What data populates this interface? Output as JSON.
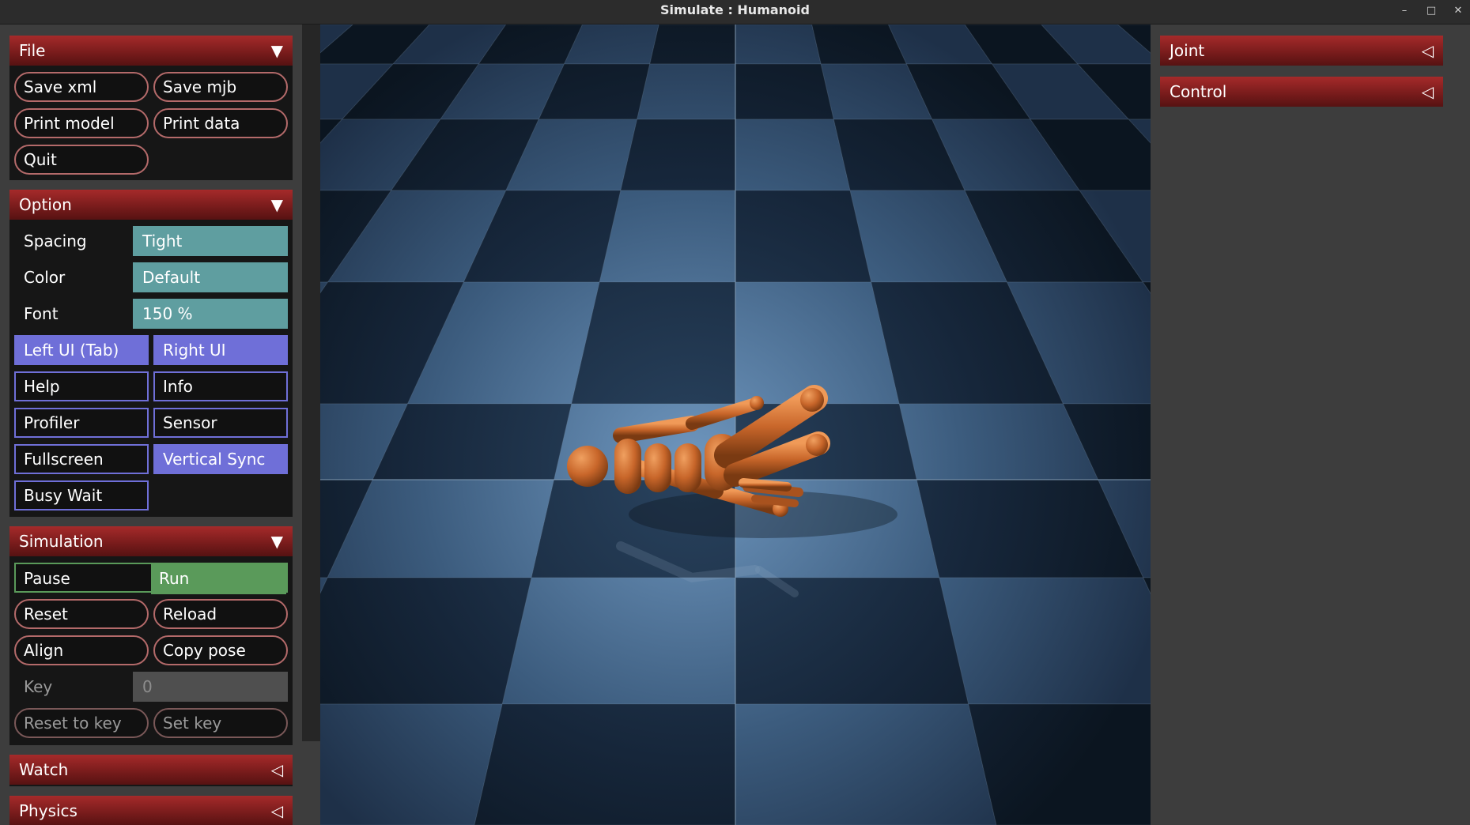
{
  "window": {
    "title": "Simulate : Humanoid",
    "controls": [
      "minimize-icon",
      "maximize-icon",
      "close-icon"
    ]
  },
  "left": {
    "file": {
      "title": "File",
      "buttons": [
        "Save xml",
        "Save mjb",
        "Print model",
        "Print data",
        "Quit"
      ]
    },
    "option": {
      "title": "Option",
      "spacing_label": "Spacing",
      "spacing_value": "Tight",
      "color_label": "Color",
      "color_value": "Default",
      "font_label": "Font",
      "font_value": "150 %",
      "toggles": [
        {
          "label": "Left UI (Tab)",
          "on": true
        },
        {
          "label": "Right UI",
          "on": true
        },
        {
          "label": "Help",
          "on": false
        },
        {
          "label": "Info",
          "on": false
        },
        {
          "label": "Profiler",
          "on": false
        },
        {
          "label": "Sensor",
          "on": false
        },
        {
          "label": "Fullscreen",
          "on": false
        },
        {
          "label": "Vertical Sync",
          "on": true
        },
        {
          "label": "Busy Wait",
          "on": false
        }
      ]
    },
    "simulation": {
      "title": "Simulation",
      "pause": "Pause",
      "run": "Run",
      "active": "Run",
      "buttons": [
        "Reset",
        "Reload",
        "Align",
        "Copy pose"
      ],
      "key_label": "Key",
      "key_value": "0",
      "reset_to_key": "Reset to key",
      "set_key": "Set key"
    },
    "watch": {
      "title": "Watch"
    },
    "physics": {
      "title": "Physics"
    }
  },
  "right": {
    "joint": {
      "title": "Joint"
    },
    "control": {
      "title": "Control"
    }
  },
  "colors": {
    "header": "#8b2323",
    "toggle_on": "#6f6fd8",
    "select": "#5f9ea0",
    "run": "#5a9a5a",
    "body": "#c8662a"
  }
}
